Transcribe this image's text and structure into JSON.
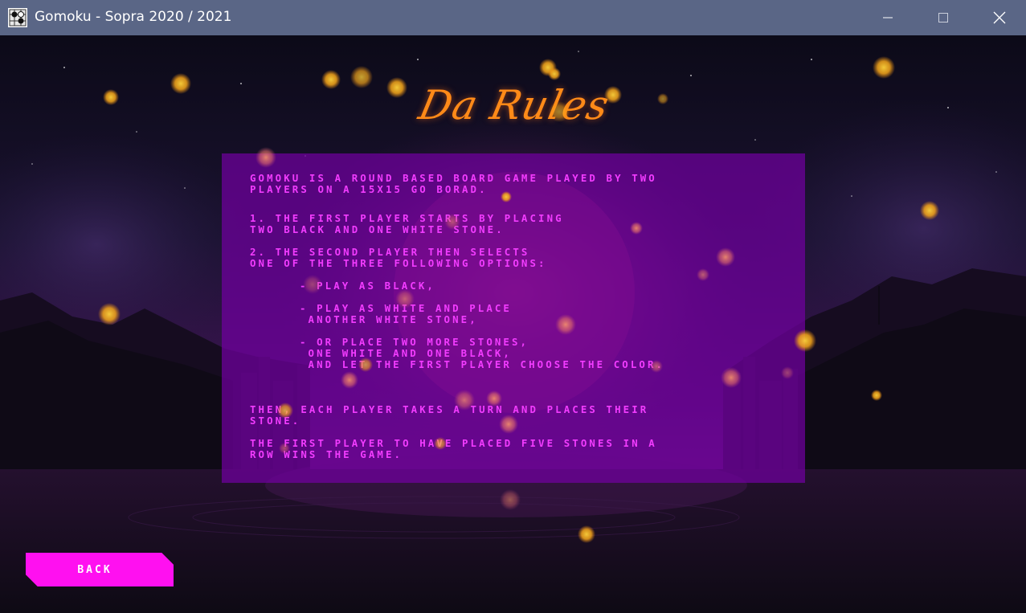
{
  "window": {
    "title": "Gomoku - Sopra 2020 / 2021",
    "controls": [
      "minimize-icon",
      "maximize-icon",
      "close-icon"
    ]
  },
  "page": {
    "heading": "Da Rules",
    "back_label": "Back"
  },
  "rules": {
    "intro": "Gomoku is a round based board game played by two\nplayers on a 15x15 Go borad.",
    "step1": "1. The first player starts by placing\ntwo black and one white stone.",
    "step2": "2. The second player then selects\none of the three following options:",
    "options": [
      "- play as black,",
      "- play as white and place\n another white stone,",
      "- or place two more stones,\n one white and one black,\n and let the first player choose the color."
    ],
    "then": "Then, each player takes a turn and places their\nstone.",
    "win": "The first player to have placed five stones in a\nrow wins the game."
  },
  "colors": {
    "titlebar": "#5a6686",
    "heading": "#ff8a18",
    "rules_text": "#f23cff",
    "panel": "#7000a0",
    "back_button": "#ff10f0"
  }
}
